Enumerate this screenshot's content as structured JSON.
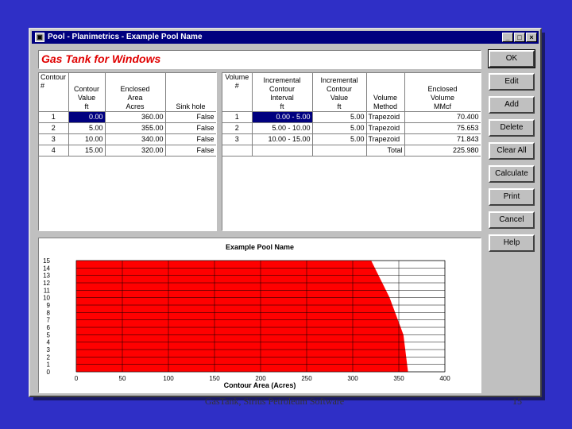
{
  "window": {
    "title": "Pool - Planimetrics - Example Pool Name",
    "controls": [
      "_",
      "□",
      "×"
    ]
  },
  "banner": "Gas Tank for Windows",
  "contour_table": {
    "headers": [
      "Contour\n#",
      "Contour\nValue\nft",
      "Enclosed\nArea\nAcres",
      "Sink hole"
    ],
    "rows": [
      [
        "1",
        "0.00",
        "360.00",
        "False"
      ],
      [
        "2",
        "5.00",
        "355.00",
        "False"
      ],
      [
        "3",
        "10.00",
        "340.00",
        "False"
      ],
      [
        "4",
        "15.00",
        "320.00",
        "False"
      ]
    ]
  },
  "volume_table": {
    "headers": [
      "Volume\n#",
      "Incremental\nContour\nInterval\nft",
      "Incremental\nContour\nValue\nft",
      "Volume\nMethod",
      "Enclosed\nVolume\nMMcf"
    ],
    "rows": [
      [
        "1",
        "0.00 - 5.00",
        "5.00",
        "Trapezoid",
        "70.400"
      ],
      [
        "2",
        "5.00 - 10.00",
        "5.00",
        "Trapezoid",
        "75.653"
      ],
      [
        "3",
        "10.00 - 15.00",
        "5.00",
        "Trapezoid",
        "71.843"
      ],
      [
        "",
        "",
        "",
        "Total",
        "225.980"
      ]
    ]
  },
  "buttons": [
    "OK",
    "Edit",
    "Add",
    "Delete",
    "Clear All",
    "Calculate",
    "Print",
    "Cancel",
    "Help"
  ],
  "chart_data": {
    "type": "area",
    "title": "Example Pool Name",
    "xlabel": "Contour Area (Acres)",
    "ylabel": "",
    "xlim": [
      0,
      400
    ],
    "ylim": [
      0,
      15
    ],
    "x_ticks": [
      "0",
      "50",
      "100",
      "150",
      "200",
      "250",
      "300",
      "350",
      "400"
    ],
    "y_ticks": [
      "0",
      "1",
      "2",
      "3",
      "4",
      "5",
      "6",
      "7",
      "8",
      "9",
      "10",
      "11",
      "12",
      "13",
      "14",
      "15"
    ],
    "grid": true,
    "fill_color": "#ff0000",
    "series": [
      {
        "x": [
          360,
          355,
          340,
          320
        ],
        "y": [
          0,
          5,
          10,
          15
        ]
      }
    ]
  },
  "footer": {
    "text": "GasTank, Sirius Petroleum Software",
    "page": "15"
  },
  "colors": {
    "desktop": "#2f2fc6",
    "titlebar": "#00007f",
    "banner_text": "#e00000",
    "selection": "#00007f"
  }
}
